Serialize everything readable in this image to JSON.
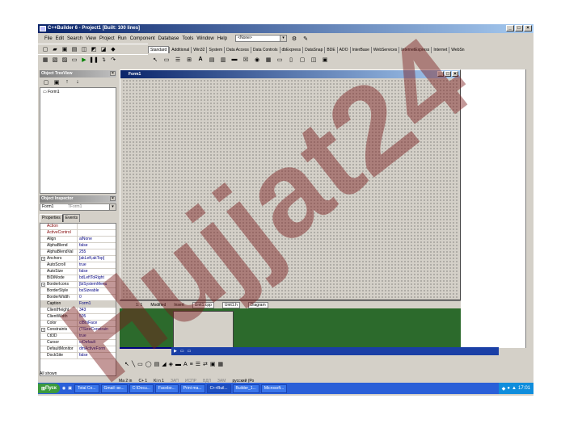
{
  "window": {
    "title": "C++Builder 6 - Project1 [Built: 100 lines]",
    "minimize": "_",
    "maximize": "□",
    "close": "×"
  },
  "menu": [
    "File",
    "Edit",
    "Search",
    "View",
    "Project",
    "Run",
    "Component",
    "Database",
    "Tools",
    "Window",
    "Help"
  ],
  "desktop_combo": "<None>",
  "palette_tabs": [
    "Standard",
    "Additional",
    "Win32",
    "System",
    "Data Access",
    "Data Controls",
    "dbExpress",
    "DataSnap",
    "BDE",
    "ADO",
    "InterBase",
    "WebServices",
    "InternetExpress",
    "Internet",
    "WebSn"
  ],
  "tree_view": {
    "title": "Object TreeView",
    "items": [
      "Form1"
    ]
  },
  "inspector": {
    "title": "Object Inspector",
    "object": "Form1",
    "object_type": "TForm1",
    "tabs": [
      "Properties",
      "Events"
    ],
    "rows": [
      {
        "name": "Action",
        "value": "",
        "event": true
      },
      {
        "name": "ActiveControl",
        "value": "",
        "event": true
      },
      {
        "name": "Align",
        "value": "alNone"
      },
      {
        "name": "AlphaBlend",
        "value": "false"
      },
      {
        "name": "AlphaBlendVal",
        "value": "255"
      },
      {
        "name": "Anchors",
        "value": "[akLeft,akTop]",
        "expand": "+"
      },
      {
        "name": "AutoScroll",
        "value": "true"
      },
      {
        "name": "AutoSize",
        "value": "false"
      },
      {
        "name": "BiDiMode",
        "value": "bdLeftToRight"
      },
      {
        "name": "BorderIcons",
        "value": "[biSystemMenu",
        "expand": "+"
      },
      {
        "name": "BorderStyle",
        "value": "bsSizeable"
      },
      {
        "name": "BorderWidth",
        "value": "0"
      },
      {
        "name": "Caption",
        "value": "Form1",
        "selected": true
      },
      {
        "name": "ClientHeight",
        "value": "343"
      },
      {
        "name": "ClientWidth",
        "value": "505"
      },
      {
        "name": "Color",
        "value": "clBtnFace"
      },
      {
        "name": "Constraints",
        "value": "(TSizeConstrain",
        "expand": "+"
      },
      {
        "name": "Ctl3D",
        "value": "true"
      },
      {
        "name": "Cursor",
        "value": "crDefault"
      },
      {
        "name": "DefaultMonitor",
        "value": "dmActiveForm"
      },
      {
        "name": "DockSite",
        "value": "false"
      }
    ],
    "footer": "All shown"
  },
  "form": {
    "title": "Form1"
  },
  "editor_status": {
    "position": "1: 1",
    "modified": "Modified",
    "mode": "Insert",
    "tabs": [
      "Unit1.cpp",
      "Unit1.h",
      "Diagram"
    ]
  },
  "status_bar": {
    "items": [
      "Ма  2 in",
      "C+ 1",
      "Ki n 1"
    ],
    "flags": [
      "ЗАП",
      "ИСПР",
      "ВДЛ",
      "ЗАМ",
      "русский (Ро"
    ]
  },
  "taskbar": {
    "start": "Пуск",
    "buttons": [
      "Total Co...",
      "Gmail: вх...",
      "C:\\Docu...",
      "Facebo...",
      "Print ma...",
      "C++Buil...",
      "Builder_1...",
      "Microsoft..."
    ],
    "active_index": 5,
    "clock": "17:01"
  },
  "watermark_text": "Hujjat24"
}
